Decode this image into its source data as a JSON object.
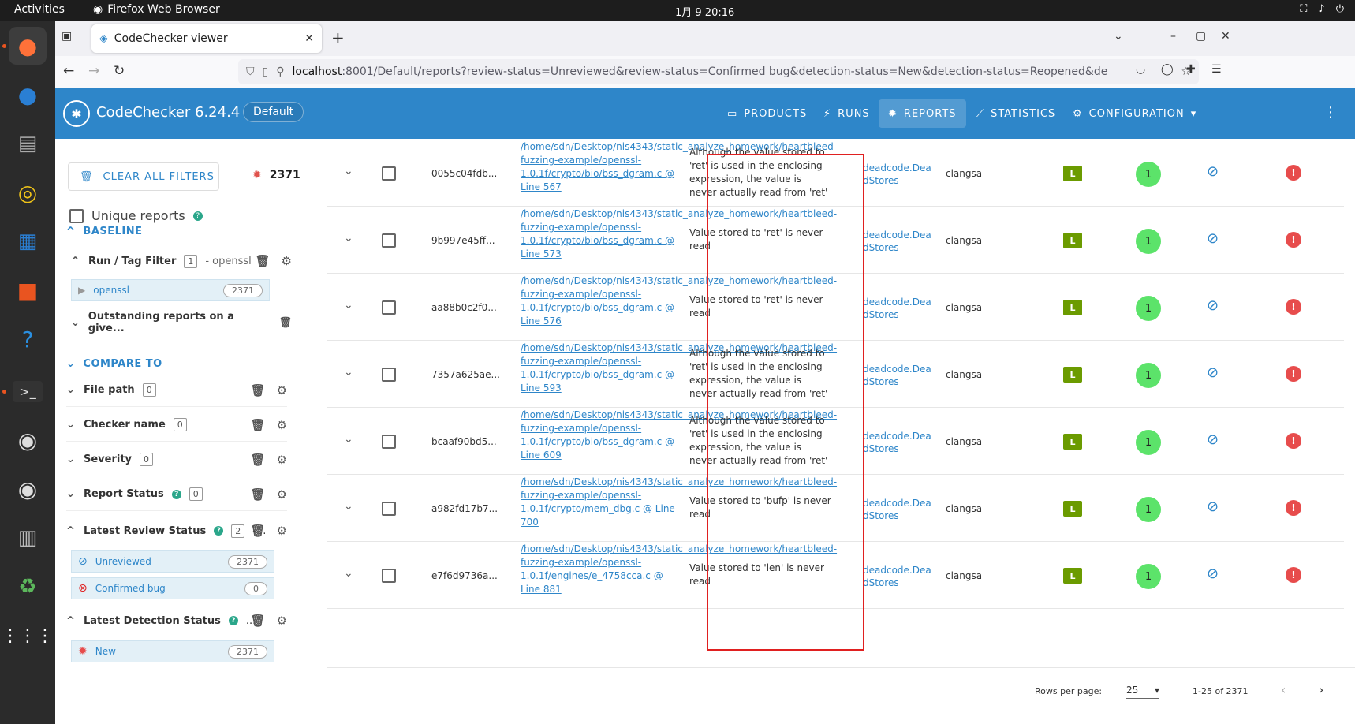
{
  "os": {
    "activities": "Activities",
    "app_name": "Firefox Web Browser",
    "clock": "1月 9  20:16"
  },
  "browser": {
    "tab_title": "CodeChecker viewer",
    "url_host": "localhost",
    "url_rest": ":8001/Default/reports?review-status=Unreviewed&review-status=Confirmed bug&detection-status=New&detection-status=Reopened&de"
  },
  "app": {
    "brand": "CodeChecker 6.24.4",
    "product": "Default",
    "menu": {
      "products": "PRODUCTS",
      "runs": "RUNS",
      "reports": "REPORTS",
      "statistics": "STATISTICS",
      "configuration": "CONFIGURATION"
    }
  },
  "sidebar": {
    "clear_all": "CLEAR ALL FILTERS",
    "total_count": "2371",
    "unique_reports": "Unique reports",
    "baseline": "BASELINE",
    "run_tag_filter": "Run / Tag Filter",
    "run_tag_count": "1",
    "run_tag_value": "- openssl",
    "run_chip_label": "openssl",
    "run_chip_count": "2371",
    "outstanding": "Outstanding reports on a give...",
    "compare_to": "COMPARE TO",
    "file_path": "File path",
    "file_path_count": "0",
    "checker_name": "Checker name",
    "checker_name_count": "0",
    "severity": "Severity",
    "severity_count": "0",
    "report_status": "Report Status",
    "report_status_count": "0",
    "latest_review_status": "Latest Review Status",
    "latest_review_count": "2",
    "latest_review_more": "-...",
    "review_chips": [
      {
        "label": "Unreviewed",
        "count": "2371"
      },
      {
        "label": "Confirmed bug",
        "count": "0"
      }
    ],
    "latest_detection_status": "Latest Detection Status",
    "latest_detection_more": "...",
    "detection_chip": {
      "label": "New",
      "count": "2371"
    }
  },
  "reports": [
    {
      "hash": "0055c04fdb...",
      "path": "/home/sdn/Desktop/nis4343/static_analyze_homework/heartbleed-fuzzing-example/openssl-1.0.1f/crypto/bio/bss_dgram.c @ Line 567",
      "message": "Although the value stored to 'ret' is used in the enclosing expression, the value is never actually read from 'ret'",
      "checker": "deadcode.DeadStores",
      "analyzer": "clangsa",
      "severity": "L",
      "bug_path": "1"
    },
    {
      "hash": "9b997e45ff...",
      "path": "/home/sdn/Desktop/nis4343/static_analyze_homework/heartbleed-fuzzing-example/openssl-1.0.1f/crypto/bio/bss_dgram.c @ Line 573",
      "message": "Value stored to 'ret' is never read",
      "checker": "deadcode.DeadStores",
      "analyzer": "clangsa",
      "severity": "L",
      "bug_path": "1"
    },
    {
      "hash": "aa88b0c2f0...",
      "path": "/home/sdn/Desktop/nis4343/static_analyze_homework/heartbleed-fuzzing-example/openssl-1.0.1f/crypto/bio/bss_dgram.c @ Line 576",
      "message": "Value stored to 'ret' is never read",
      "checker": "deadcode.DeadStores",
      "analyzer": "clangsa",
      "severity": "L",
      "bug_path": "1"
    },
    {
      "hash": "7357a625ae...",
      "path": "/home/sdn/Desktop/nis4343/static_analyze_homework/heartbleed-fuzzing-example/openssl-1.0.1f/crypto/bio/bss_dgram.c @ Line 593",
      "message": "Although the value stored to 'ret' is used in the enclosing expression, the value is never actually read from 'ret'",
      "checker": "deadcode.DeadStores",
      "analyzer": "clangsa",
      "severity": "L",
      "bug_path": "1"
    },
    {
      "hash": "bcaaf90bd5...",
      "path": "/home/sdn/Desktop/nis4343/static_analyze_homework/heartbleed-fuzzing-example/openssl-1.0.1f/crypto/bio/bss_dgram.c @ Line 609",
      "message": "Although the value stored to 'ret' is used in the enclosing expression, the value is never actually read from 'ret'",
      "checker": "deadcode.DeadStores",
      "analyzer": "clangsa",
      "severity": "L",
      "bug_path": "1"
    },
    {
      "hash": "a982fd17b7...",
      "path": "/home/sdn/Desktop/nis4343/static_analyze_homework/heartbleed-fuzzing-example/openssl-1.0.1f/crypto/mem_dbg.c @ Line 700",
      "message": "Value stored to 'bufp' is never read",
      "checker": "deadcode.DeadStores",
      "analyzer": "clangsa",
      "severity": "L",
      "bug_path": "1"
    },
    {
      "hash": "e7f6d9736a...",
      "path": "/home/sdn/Desktop/nis4343/static_analyze_homework/heartbleed-fuzzing-example/openssl-1.0.1f/engines/e_4758cca.c @ Line 881",
      "message": "Value stored to 'len' is never read",
      "checker": "deadcode.DeadStores",
      "analyzer": "clangsa",
      "severity": "L",
      "bug_path": "1"
    }
  ],
  "pagination": {
    "rows_per_page_label": "Rows per page:",
    "rows_per_page": "25",
    "range": "1-25 of 2371"
  },
  "colors": {
    "primary": "#2e86c9",
    "severity_low": "#6b9b00",
    "bug_path": "#5ce36a",
    "detection_new": "#e74c4c",
    "highlight": "#e02020"
  }
}
